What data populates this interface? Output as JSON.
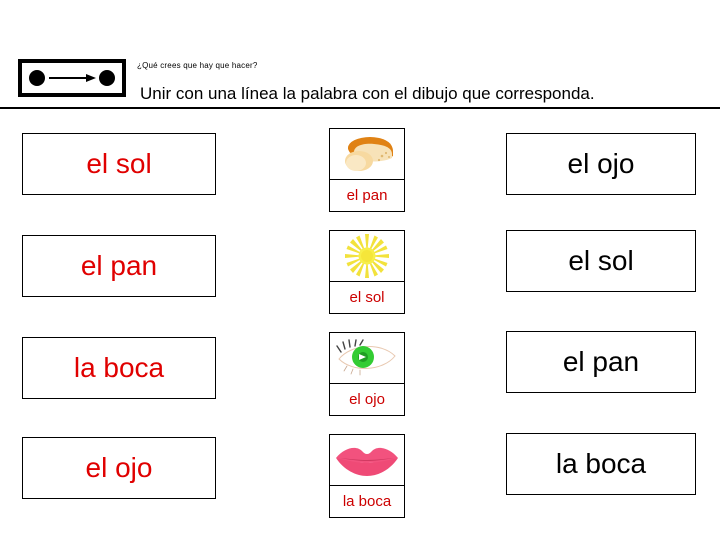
{
  "header": {
    "symbol_icon": "two-dots-arrow-icon",
    "hint": "¿Qué crees que hay que hacer?",
    "instruction": "Unir con una línea la palabra con el dibujo que corresponda."
  },
  "colors": {
    "left_word_text": "#e00000",
    "right_word_text": "#000000",
    "picture_label_text": "#cc0000",
    "border": "#000000",
    "background": "#ffffff",
    "bread_crust": "#e08214",
    "bread_crumb": "#f5d6a0",
    "sun": "#f2e23c",
    "eye_iris": "#33cc33",
    "lips": "#f2527e"
  },
  "exercise": {
    "left_column": [
      {
        "label": "el sol"
      },
      {
        "label": "el pan"
      },
      {
        "label": "la boca"
      },
      {
        "label": "el ojo"
      }
    ],
    "middle_column": [
      {
        "icon": "bread-icon",
        "label": "el pan"
      },
      {
        "icon": "sun-icon",
        "label": "el sol"
      },
      {
        "icon": "eye-icon",
        "label": "el ojo"
      },
      {
        "icon": "lips-icon",
        "label": "la boca"
      }
    ],
    "right_column": [
      {
        "label": "el ojo"
      },
      {
        "label": "el sol"
      },
      {
        "label": "el pan"
      },
      {
        "label": "la boca"
      }
    ]
  }
}
